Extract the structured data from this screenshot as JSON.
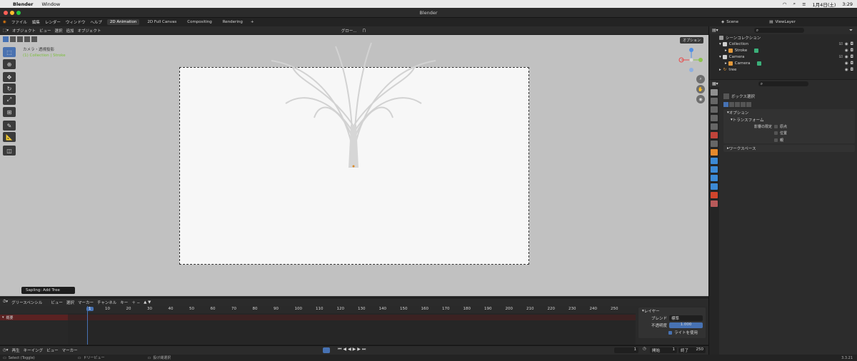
{
  "macbar": {
    "apple": "",
    "app": "Blender",
    "menu1": "Window",
    "date": "1月4日(土)",
    "time": "3:29"
  },
  "window": {
    "title": "Blender"
  },
  "menubar": {
    "items": [
      "ファイル",
      "編集",
      "レンダー",
      "ウィンドウ",
      "ヘルプ"
    ],
    "tabs": [
      "2D Animation",
      "2D Full Canvas",
      "Compositing",
      "Rendering"
    ],
    "add_tab": "+"
  },
  "viewport_header": {
    "mode": "オブジェクト",
    "menus": [
      "ビュー",
      "選択",
      "追加",
      "オブジェクト"
    ],
    "orientation": "グロー..."
  },
  "viewport": {
    "cam_line1": "カメラ・透視投影",
    "cam_line2": "(1) Collection | Stroke",
    "options": "オプション"
  },
  "toast": "Sapling: Add Tree",
  "timeline": {
    "editor": "グリースペンシル",
    "menus": [
      "ビュー",
      "選択",
      "マーカー",
      "チャンネル",
      "キー"
    ],
    "frames": [
      "1",
      "10",
      "20",
      "30",
      "40",
      "50",
      "60",
      "70",
      "80",
      "90",
      "100",
      "110",
      "120",
      "130",
      "140",
      "150",
      "160",
      "170",
      "180",
      "190",
      "200",
      "210",
      "220",
      "230",
      "240",
      "250"
    ],
    "layer_row": "概要",
    "side_title": "レイヤー",
    "blend_label": "ブレンド",
    "blend_value": "標準",
    "opacity_label": "不透明度",
    "opacity_value": "1.000",
    "lights": "ライトを使用"
  },
  "playbar": {
    "playback": "再生",
    "keying": "キーイング",
    "view": "ビュー",
    "marker": "マーカー",
    "current": "1",
    "start_label": "開始",
    "start": "1",
    "end_label": "終了",
    "end": "250"
  },
  "statusbar": {
    "a": "Select (Toggle)",
    "b": "ドリービュー",
    "c": "投げ縄選択",
    "version": "3.3.21"
  },
  "outliner": {
    "scene": "Scene",
    "viewlayer": "ViewLayer",
    "rows": [
      {
        "label": "シーンコレクション"
      },
      {
        "label": "Collection"
      },
      {
        "label": "Stroke"
      },
      {
        "label": "Camera"
      },
      {
        "label": "Camera"
      },
      {
        "label": "tree"
      }
    ]
  },
  "properties": {
    "tool": "ボックス選択",
    "options": "オプション",
    "transform": "トランスフォーム",
    "affect_label": "影響の限定",
    "origin": "原点",
    "location": "位置",
    "parents": "親",
    "workspace": "ワークスペース"
  }
}
